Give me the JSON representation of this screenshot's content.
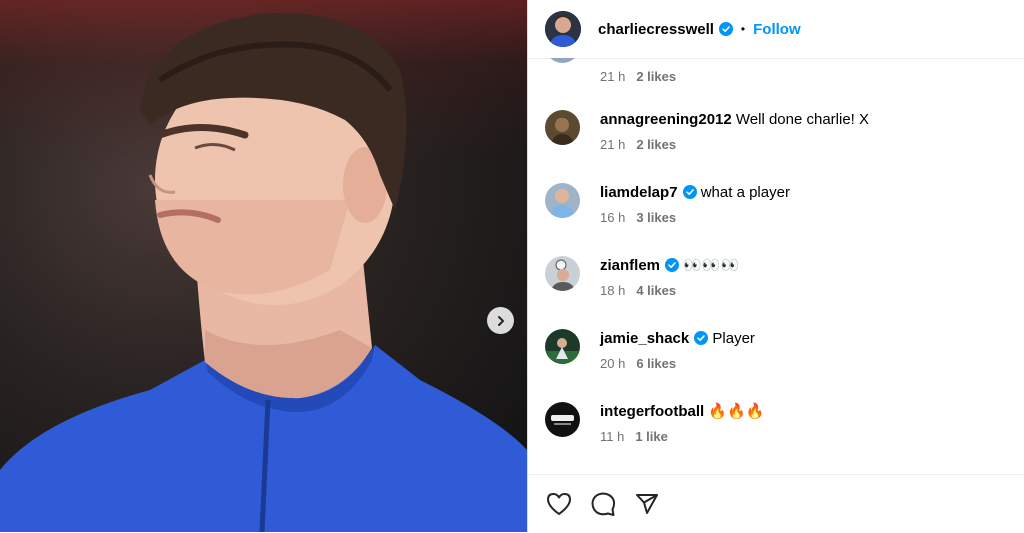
{
  "post": {
    "username": "charliecresswell",
    "follow_label": "Follow",
    "separator": "•"
  },
  "comments": [
    {
      "username": "",
      "text": "",
      "time": "21 h",
      "likes": "2 likes",
      "verified": false
    },
    {
      "username": "annagreening2012",
      "text": "Well done charlie! X",
      "time": "21 h",
      "likes": "2 likes",
      "verified": false
    },
    {
      "username": "liamdelap7",
      "text": "what a player",
      "time": "16 h",
      "likes": "3 likes",
      "verified": true
    },
    {
      "username": "zianflem",
      "text": "👀👀👀",
      "time": "18 h",
      "likes": "4 likes",
      "verified": true
    },
    {
      "username": "jamie_shack",
      "text": "Player",
      "time": "20 h",
      "likes": "6 likes",
      "verified": true
    },
    {
      "username": "integerfootball",
      "text": "🔥🔥🔥",
      "time": "11 h",
      "likes": "1 like",
      "verified": false
    }
  ],
  "icons": {
    "verified": "verified-badge-icon",
    "next": "chevron-right-icon",
    "like": "heart-icon",
    "comment": "comment-icon",
    "share": "paper-plane-icon"
  },
  "colors": {
    "accent": "#0095f6",
    "verified": "#0095f6",
    "muted": "#737373",
    "jersey": "#2f5bd6"
  }
}
